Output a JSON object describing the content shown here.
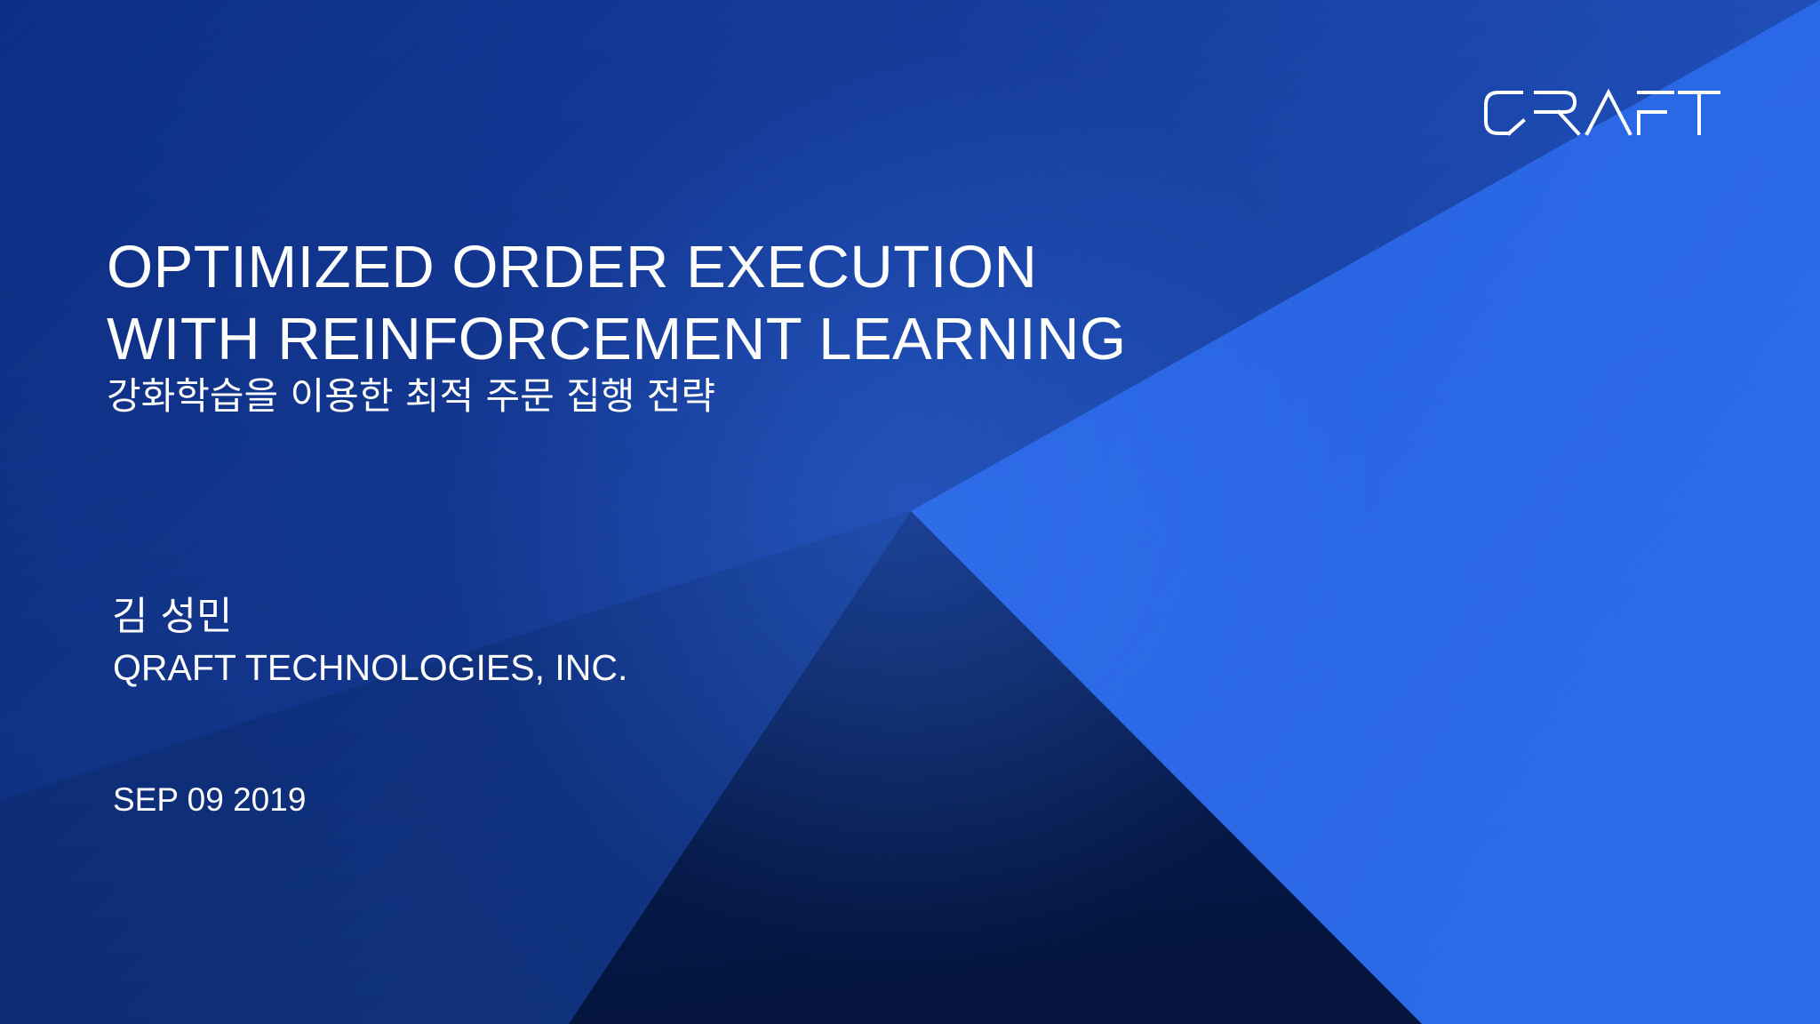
{
  "slide": {
    "logo_text": "QRAFT",
    "title_lines": [
      "OPTIMIZED ORDER EXECUTION",
      "WITH REINFORCEMENT LEARNING"
    ],
    "subtitle": "강화학습을 이용한 최적 주문 집행 전략",
    "author": "김 성민",
    "company": "QRAFT TECHNOLOGIES, INC.",
    "date": "SEP 09 2019"
  },
  "colors": {
    "background_dark": "#0a1f5c",
    "background_mid": "#1a3fa0",
    "background_light": "#2f6ff0",
    "text": "#ffffff"
  }
}
